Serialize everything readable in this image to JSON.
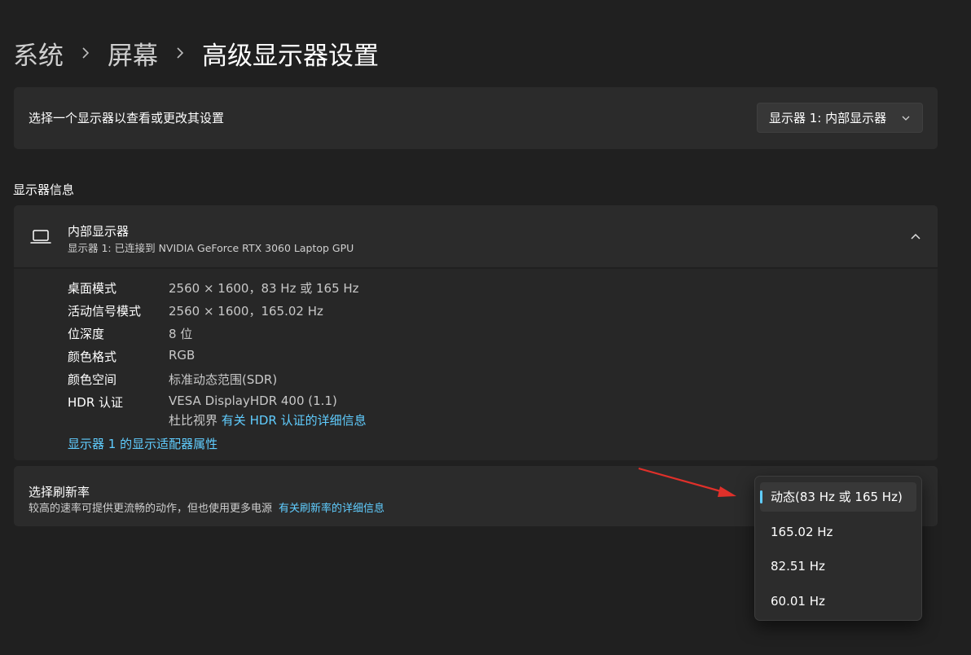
{
  "breadcrumb": {
    "items": [
      "系统",
      "屏幕",
      "高级显示器设置"
    ]
  },
  "display_select": {
    "label": "选择一个显示器以查看或更改其设置",
    "value": "显示器 1: 内部显示器"
  },
  "section_title": "显示器信息",
  "display_info": {
    "title": "内部显示器",
    "subtitle": "显示器 1: 已连接到 NVIDIA GeForce RTX 3060 Laptop GPU",
    "rows": [
      {
        "key": "桌面模式",
        "value": "2560 × 1600，83 Hz 或 165 Hz"
      },
      {
        "key": "活动信号模式",
        "value": "2560 × 1600，165.02 Hz"
      },
      {
        "key": "位深度",
        "value": "8 位"
      },
      {
        "key": "颜色格式",
        "value": "RGB"
      },
      {
        "key": "颜色空间",
        "value": "标准动态范围(SDR)"
      },
      {
        "key": "HDR 认证",
        "value": "VESA DisplayHDR 400 (1.1)"
      }
    ],
    "dolby_prefix": "杜比视界",
    "hdr_link": "有关 HDR 认证的详细信息",
    "adapter_link": "显示器 1 的显示适配器属性"
  },
  "refresh": {
    "title": "选择刷新率",
    "desc": "较高的速率可提供更流畅的动作，但也使用更多电源",
    "link": "有关刷新率的详细信息",
    "options": [
      "动态(83 Hz 或 165 Hz)",
      "165.02 Hz",
      "82.51 Hz",
      "60.01 Hz"
    ],
    "selected_index": 0
  },
  "colors": {
    "background": "#202020",
    "card": "#2b2b2b",
    "accent": "#60cdff",
    "annotation_arrow": "#e0302a"
  }
}
